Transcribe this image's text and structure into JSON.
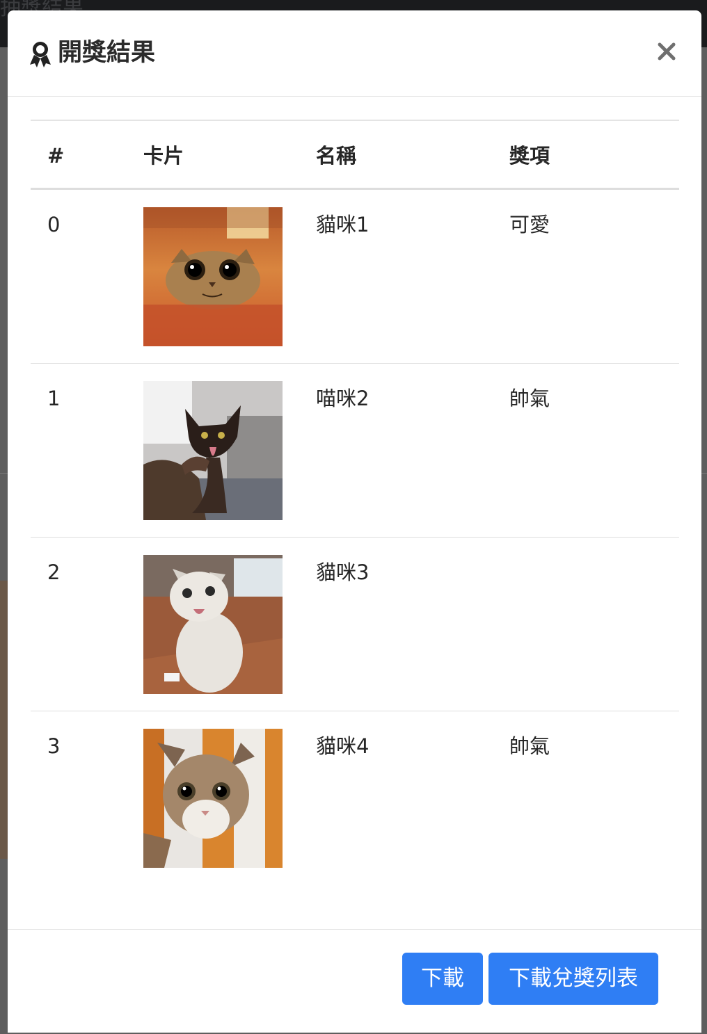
{
  "background": {
    "title": "抽獎結果"
  },
  "modal": {
    "title": "開獎結果",
    "close_label": "×"
  },
  "table": {
    "headers": {
      "num": "#",
      "card": "卡片",
      "name": "名稱",
      "prize": "獎項"
    },
    "rows": [
      {
        "num": "0",
        "name": "貓咪1",
        "prize": "可愛",
        "card_image": "cat-photo-1"
      },
      {
        "num": "1",
        "name": "喵咪2",
        "prize": "帥氣",
        "card_image": "cat-photo-2"
      },
      {
        "num": "2",
        "name": "貓咪3",
        "prize": "",
        "card_image": "cat-photo-3"
      },
      {
        "num": "3",
        "name": "貓咪4",
        "prize": "帥氣",
        "card_image": "cat-photo-4"
      }
    ]
  },
  "footer": {
    "download_label": "下載",
    "download_list_label": "下載兌獎列表"
  },
  "colors": {
    "primary_button": "#2f7ef4",
    "backdrop": "#5e5e5e",
    "topbar": "#1a1b1d"
  },
  "icons": {
    "award": "award-icon",
    "close": "close-icon"
  }
}
